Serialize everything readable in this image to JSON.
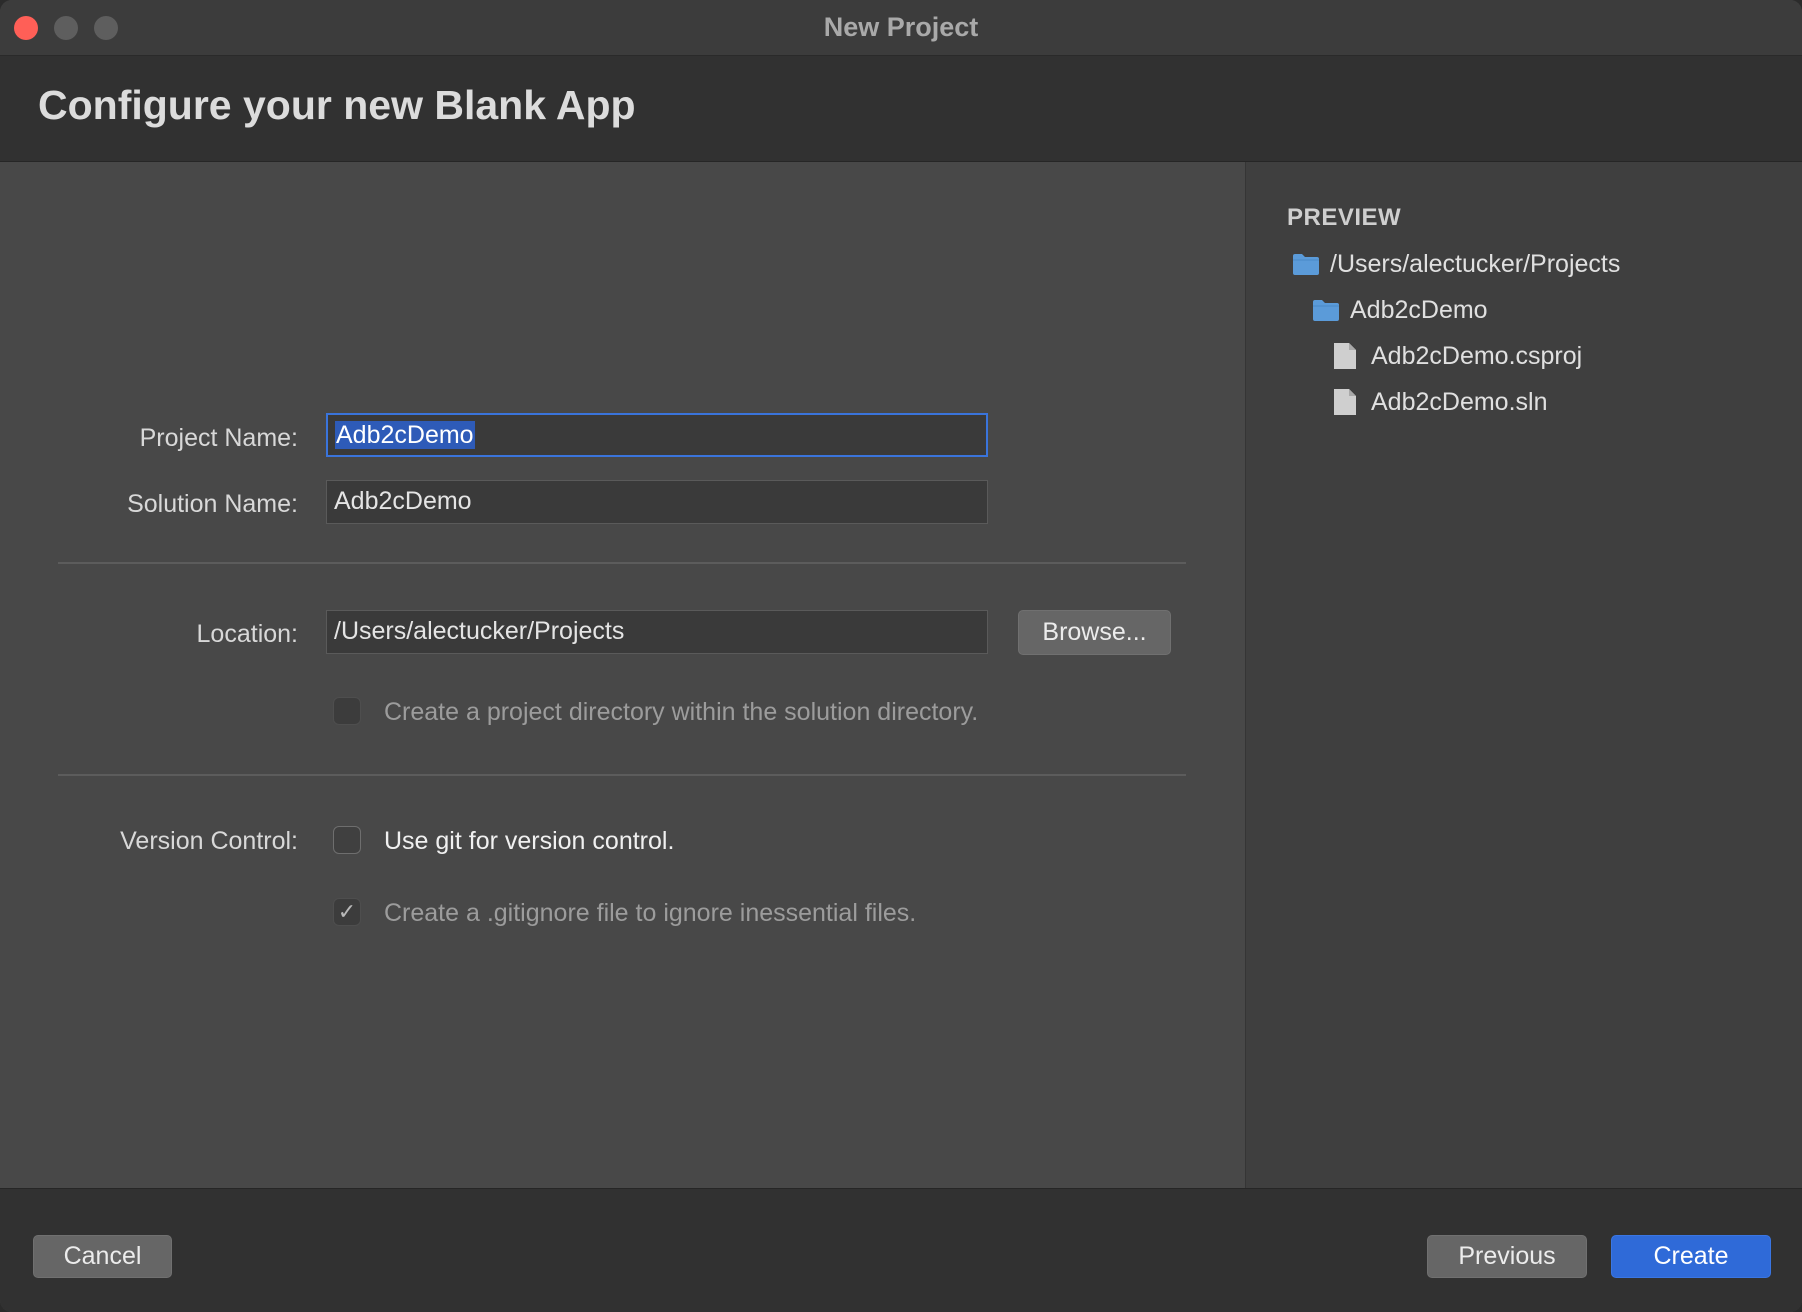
{
  "window": {
    "title": "New Project"
  },
  "header": {
    "title": "Configure your new Blank App"
  },
  "form": {
    "project_name_label": "Project Name:",
    "project_name_value": "Adb2cDemo",
    "solution_name_label": "Solution Name:",
    "solution_name_value": "Adb2cDemo",
    "location_label": "Location:",
    "location_value": "/Users/alectucker/Projects",
    "browse_label": "Browse...",
    "project_dir_checkbox": {
      "label": "Create a project directory within the solution directory.",
      "checked": false,
      "enabled": false
    },
    "version_control_label": "Version Control:",
    "git_checkbox": {
      "label": "Use git for version control.",
      "checked": false,
      "enabled": true
    },
    "gitignore_checkbox": {
      "label": "Create a .gitignore file to ignore inessential files.",
      "checked": true,
      "enabled": false
    }
  },
  "preview": {
    "heading": "PREVIEW",
    "tree": [
      {
        "name": "/Users/alectucker/Projects",
        "icon": "folder-icon",
        "depth": 0
      },
      {
        "name": "Adb2cDemo",
        "icon": "folder-icon",
        "depth": 1
      },
      {
        "name": "Adb2cDemo.csproj",
        "icon": "file-icon",
        "depth": 2
      },
      {
        "name": "Adb2cDemo.sln",
        "icon": "file-icon",
        "depth": 2
      }
    ]
  },
  "footer": {
    "cancel_label": "Cancel",
    "previous_label": "Previous",
    "create_label": "Create"
  },
  "colors": {
    "accent": "#2f6ad8",
    "close": "#ff5f57",
    "folder": "#5b9bd9"
  }
}
